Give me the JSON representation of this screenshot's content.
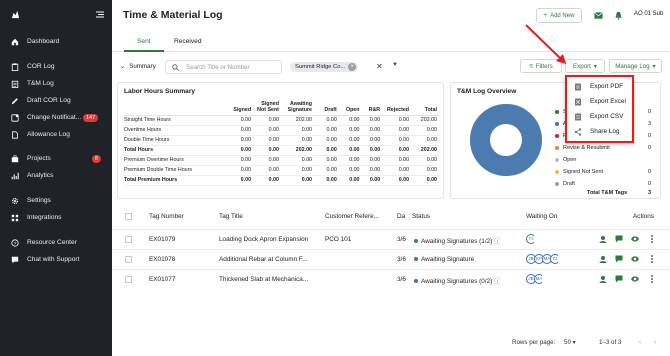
{
  "sidebar": {
    "items": [
      {
        "label": "Dashboard",
        "icon": "home-icon"
      },
      {
        "label": "COR Log",
        "icon": "clipboard-icon"
      },
      {
        "label": "T&M Log",
        "icon": "clipboard-list-icon"
      },
      {
        "label": "Draft COR Log",
        "icon": "pencil-icon"
      },
      {
        "label": "Change Notificat...",
        "icon": "notification-icon",
        "badge": "147"
      },
      {
        "label": "Allowance Log",
        "icon": "document-icon"
      },
      {
        "label": "Projects",
        "icon": "briefcase-icon",
        "badge": "8"
      },
      {
        "label": "Analytics",
        "icon": "chart-icon"
      },
      {
        "label": "Settings",
        "icon": "gear-icon"
      },
      {
        "label": "Integrations",
        "icon": "grid-icon"
      },
      {
        "label": "Resource Center",
        "icon": "help-icon"
      },
      {
        "label": "Chat with Support",
        "icon": "chat-icon"
      }
    ]
  },
  "header": {
    "title": "Time & Material Log",
    "add_new": "Add New",
    "user": "AO 01 Sub"
  },
  "tabs": {
    "sent": "Sent",
    "received": "Received"
  },
  "filters": {
    "summary": "Summary",
    "search_placeholder": "Search Title or Number",
    "chip": "Summit Ridge Co...",
    "filters_label": "Filters",
    "export_label": "Export",
    "manage_log_label": "Manage Log"
  },
  "export_menu": {
    "items": [
      {
        "label": "Export PDF",
        "icon": "pdf-icon"
      },
      {
        "label": "Export Excel",
        "icon": "excel-icon"
      },
      {
        "label": "Export CSV",
        "icon": "csv-icon"
      },
      {
        "label": "Share Log",
        "icon": "share-icon"
      }
    ]
  },
  "labor_summary": {
    "title": "Labor Hours Summary",
    "headers": [
      "Labor Hours",
      "Signed",
      "Signed Not Sent",
      "Awaiting Signature",
      "Draft",
      "Open",
      "R&R",
      "Rejected",
      "Total"
    ],
    "rows": [
      {
        "label": "Straight Time Hours",
        "values": [
          "0.00",
          "0.00",
          "202.00",
          "0.00",
          "0.00",
          "0.00",
          "0.00",
          "202.00"
        ],
        "bold": false
      },
      {
        "label": "Overtime Hours",
        "values": [
          "0.00",
          "0.00",
          "0.00",
          "0.00",
          "0.00",
          "0.00",
          "0.00",
          "0.00"
        ],
        "bold": false
      },
      {
        "label": "Double Time Hours",
        "values": [
          "0.00",
          "0.00",
          "0.00",
          "0.00",
          "0.00",
          "0.00",
          "0.00",
          "0.00"
        ],
        "bold": false
      },
      {
        "label": "Total Hours",
        "values": [
          "0.00",
          "0.00",
          "202.00",
          "0.00",
          "0.00",
          "0.00",
          "0.00",
          "202.00"
        ],
        "bold": true
      },
      {
        "label": "Premium Overtime Hours",
        "values": [
          "0.00",
          "0.00",
          "0.00",
          "0.00",
          "0.00",
          "0.00",
          "0.00",
          "0.00"
        ],
        "bold": false
      },
      {
        "label": "Premium Double Time Hours",
        "values": [
          "0.00",
          "0.00",
          "0.00",
          "0.00",
          "0.00",
          "0.00",
          "0.00",
          "0.00"
        ],
        "bold": false
      },
      {
        "label": "Total Premium Hours",
        "values": [
          "0.00",
          "0.00",
          "0.00",
          "0.00",
          "0.00",
          "0.00",
          "0.00",
          "0.00"
        ],
        "bold": true
      }
    ]
  },
  "overview": {
    "title": "T&M Log Overview",
    "legend": [
      {
        "label": "Sig...",
        "value": "0",
        "color": "#2e7d32"
      },
      {
        "label": "Awa...",
        "value": "3",
        "color": "#3b6fb6"
      },
      {
        "label": "Re...",
        "value": "0",
        "color": "#c62828"
      },
      {
        "label": "Revise & Resubmit",
        "value": "0",
        "color": "#e08a2a"
      },
      {
        "label": "Open",
        "value": "",
        "color": "#bdbdbd"
      },
      {
        "label": "Signed Not Sent",
        "value": "0",
        "color": "#f2b84b"
      },
      {
        "label": "Draft",
        "value": "0",
        "color": "#9e9e9e"
      }
    ],
    "total_label": "Total T&M Tags",
    "total_value": "3",
    "chart_color": "#4c7bb0"
  },
  "list": {
    "headers": {
      "number": "Tag Number",
      "title": "Tag Title",
      "ref": "Customer Refere...",
      "date": "Da",
      "status": "Status",
      "waiting": "Waiting On",
      "actions": "Actions"
    },
    "rows": [
      {
        "number": "EX01079",
        "title": "Loading Dock Apron Expansion",
        "ref": "PCO 101",
        "date": "3/6",
        "status": "Awaiting Signatures (1/2)",
        "help": true,
        "avatars": [
          "TJ"
        ]
      },
      {
        "number": "EX01078",
        "title": "Additional Rebar at Column F...",
        "ref": "",
        "date": "3/6",
        "status": "Awaiting Signature",
        "help": false,
        "avatars": [
          "JB",
          "KP",
          "MA",
          "TJ"
        ]
      },
      {
        "number": "EX01077",
        "title": "Thickened Slab at Mechanica...",
        "ref": "",
        "date": "3/6",
        "status": "Awaiting Signatures (0/2)",
        "help": true,
        "avatars": [
          "JB",
          "MA"
        ]
      }
    ]
  },
  "pagination": {
    "rows_per_page_label": "Rows per page:",
    "rows_per_page": "50",
    "range": "1–3 of 3"
  },
  "colors": {
    "accent": "#2d7a3a",
    "sidebar": "#1f2327",
    "highlight": "#e02020",
    "status": "#3b6fb6"
  }
}
